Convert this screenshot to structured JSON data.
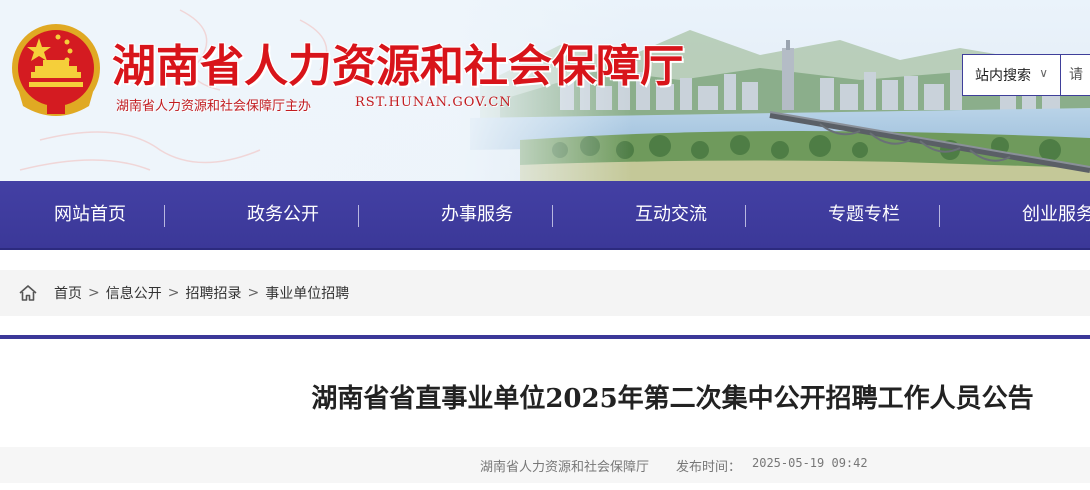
{
  "header": {
    "site_title": "湖南省人力资源和社会保障厅",
    "sponsor": "湖南省人力资源和社会保障厅主办",
    "domain": "RST.HUNAN.GOV.CN"
  },
  "search": {
    "scope_label": "站内搜索",
    "placeholder": "请"
  },
  "nav": {
    "items": [
      {
        "label": "网站首页"
      },
      {
        "label": "政务公开"
      },
      {
        "label": "办事服务"
      },
      {
        "label": "互动交流"
      },
      {
        "label": "专题专栏"
      },
      {
        "label": "创业服务"
      }
    ]
  },
  "breadcrumb": {
    "items": [
      "首页",
      "信息公开",
      "招聘招录",
      "事业单位招聘"
    ],
    "separator": ">"
  },
  "article": {
    "title": "湖南省省直事业单位2025年第二次集中公开招聘工作人员公告",
    "source": "湖南省人力资源和社会保障厅",
    "publish_label": "发布时间：",
    "publish_time": "2025-05-19 09:42"
  },
  "colors": {
    "brand_red": "#d8141a",
    "nav_blue": "#403da0",
    "divider": "#3b3898"
  },
  "icons": {
    "home": "home-icon",
    "dropdown": "chevron-down-icon",
    "emblem": "national-emblem"
  }
}
